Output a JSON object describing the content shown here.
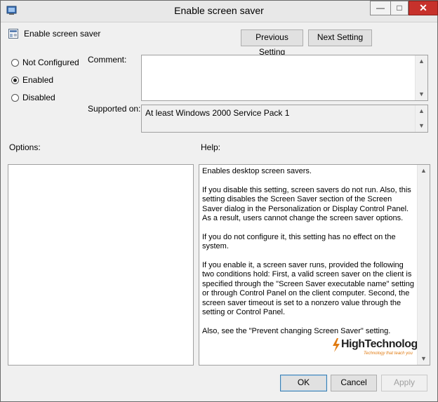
{
  "window": {
    "title": "Enable screen saver",
    "minimize_label": "—",
    "maximize_label": "□",
    "close_label": "✕"
  },
  "header": {
    "policy_name": "Enable screen saver",
    "previous_label": "Previous Setting",
    "next_label": "Next Setting"
  },
  "state": {
    "options": [
      {
        "label": "Not Configured",
        "selected": false
      },
      {
        "label": "Enabled",
        "selected": true
      },
      {
        "label": "Disabled",
        "selected": false
      }
    ]
  },
  "comment": {
    "label": "Comment:",
    "value": ""
  },
  "supported": {
    "label": "Supported on:",
    "value": "At least Windows 2000 Service Pack 1"
  },
  "options_panel": {
    "label": "Options:"
  },
  "help": {
    "label": "Help:",
    "paragraphs": [
      "Enables desktop screen savers.",
      "If you disable this setting, screen savers do not run. Also, this setting disables the Screen Saver section of the Screen Saver dialog in the Personalization or Display Control Panel. As a result, users cannot change the screen saver options.",
      "If you do not configure it, this setting has no effect on the system.",
      "If you enable it, a screen saver runs, provided the following two conditions hold: First, a valid screen saver on the client is specified through the \"Screen Saver executable name\" setting or through Control Panel on the client computer. Second, the screen saver timeout is set to a nonzero value through the setting or Control Panel.",
      "Also, see the \"Prevent changing Screen Saver\" setting."
    ],
    "watermark": "HighTechnology",
    "watermark_tagline": "Technology that teach you"
  },
  "footer": {
    "ok_label": "OK",
    "cancel_label": "Cancel",
    "apply_label": "Apply"
  },
  "colors": {
    "accent": "#3c7fb1",
    "close_button": "#c7312b",
    "watermark_orange": "#e07a10"
  }
}
